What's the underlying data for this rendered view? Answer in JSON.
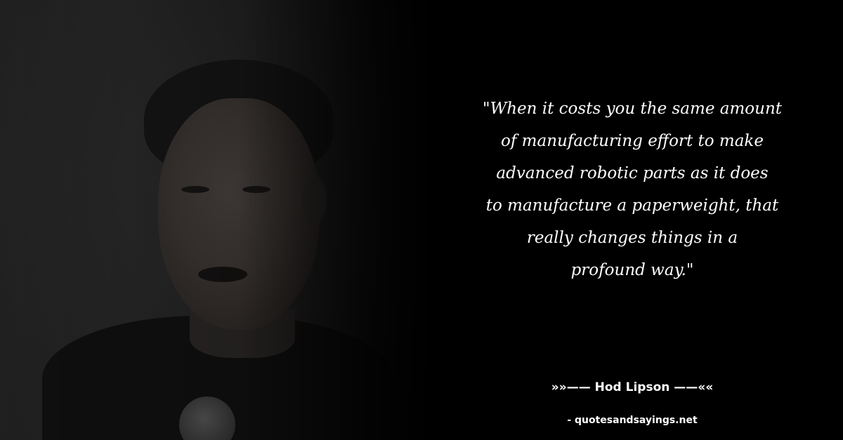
{
  "quote": {
    "lines": [
      "\"When it costs you the same amount",
      "of manufacturing effort to make",
      "advanced robotic parts as it does",
      "to manufacture a paperweight, that",
      "really changes things in a",
      "profound way.\""
    ]
  },
  "author": {
    "text": "»»—— Hod Lipson ——««"
  },
  "source": {
    "text": "- quotesandsayings.net"
  },
  "colors": {
    "background": "#000000",
    "text": "#ffffff"
  }
}
